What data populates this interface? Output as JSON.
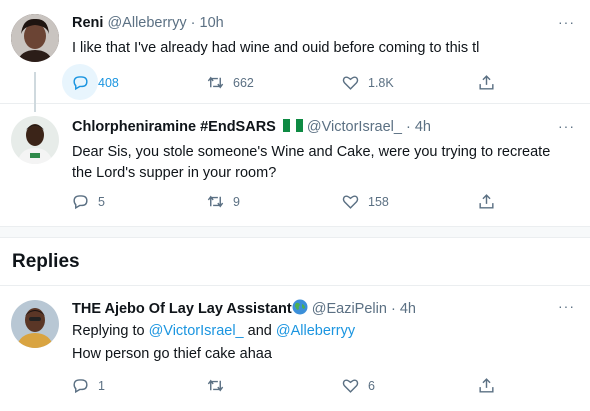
{
  "tweets": [
    {
      "name": "Reni",
      "handle": "@Alleberryy",
      "sep": "·",
      "time": "10h",
      "text": "I like that I've already had wine and ouid before coming to this tl",
      "replies": "408",
      "retweets": "662",
      "likes": "1.8K"
    },
    {
      "name": "Chlorpheniramine #EndSARS",
      "handle": "@VictorIsrael_",
      "sep": "·",
      "time": "4h",
      "text": "Dear Sis, you stole someone's Wine and Cake, were you trying to recreate the Lord's supper in your room?",
      "replies": "5",
      "retweets": "9",
      "likes": "158"
    },
    {
      "name": "THE Ajebo Of Lay Lay Assistant",
      "handle": "@EaziPelin",
      "sep": "·",
      "time": "4h",
      "replying_prefix": "Replying to",
      "replying_user1": "@VictorIsrael_",
      "replying_and": "and",
      "replying_user2": "@Alleberryy",
      "text": "How person go thief cake ahaa",
      "replies": "1",
      "retweets": "",
      "likes": "6"
    }
  ],
  "section_title": "Replies",
  "more_label": "···",
  "colors": {
    "accent": "#1b95e0",
    "muted": "#5b7083",
    "border": "#ebeef0"
  },
  "icons": [
    "reply-icon",
    "retweet-icon",
    "like-icon",
    "share-icon",
    "more-icon",
    "nigeria-flag-icon",
    "globe-icon"
  ]
}
